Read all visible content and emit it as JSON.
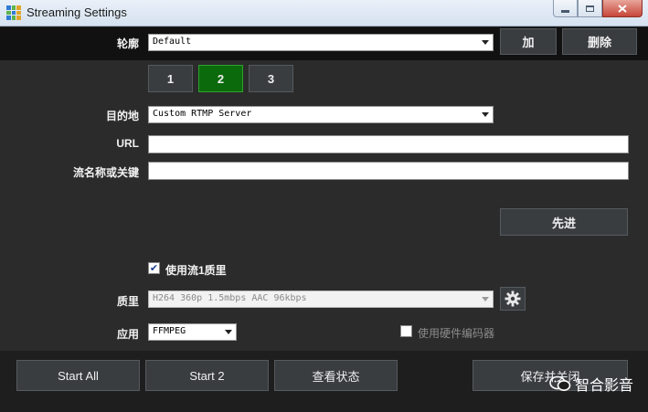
{
  "window": {
    "title": "Streaming Settings",
    "minimize_icon": "minimize-icon",
    "maximize_icon": "maximize-icon",
    "close_icon": "close-icon",
    "close_color": "#c7463a"
  },
  "profile": {
    "label": "轮廓",
    "value": "Default",
    "add_label": "加",
    "delete_label": "删除"
  },
  "stream_tabs": [
    {
      "label": "1",
      "active": false
    },
    {
      "label": "2",
      "active": true
    },
    {
      "label": "3",
      "active": false
    }
  ],
  "accent_color": "#0b6a0b",
  "destination": {
    "label": "目的地",
    "value": "Custom RTMP Server"
  },
  "url": {
    "label": "URL",
    "value": ""
  },
  "stream_key": {
    "label": "流名称或关键",
    "value": ""
  },
  "advanced_label": "先进",
  "use_stream1_quality": {
    "label": "使用流1质里",
    "checked": true
  },
  "quality": {
    "label": "质里",
    "value": "H264 360p 1.5mbps AAC 96kbps",
    "gear_icon": "gear-icon"
  },
  "application": {
    "label": "应用",
    "value": "FFMPEG"
  },
  "hardware_encoder": {
    "label": "使用硬件编码器",
    "checked": false
  },
  "footer": {
    "start_all": "Start All",
    "start_2": "Start 2",
    "view_status": "查看状态",
    "save_close": "保存并关闭"
  },
  "watermark": {
    "text": "智合影音",
    "icon": "wechat-icon"
  }
}
